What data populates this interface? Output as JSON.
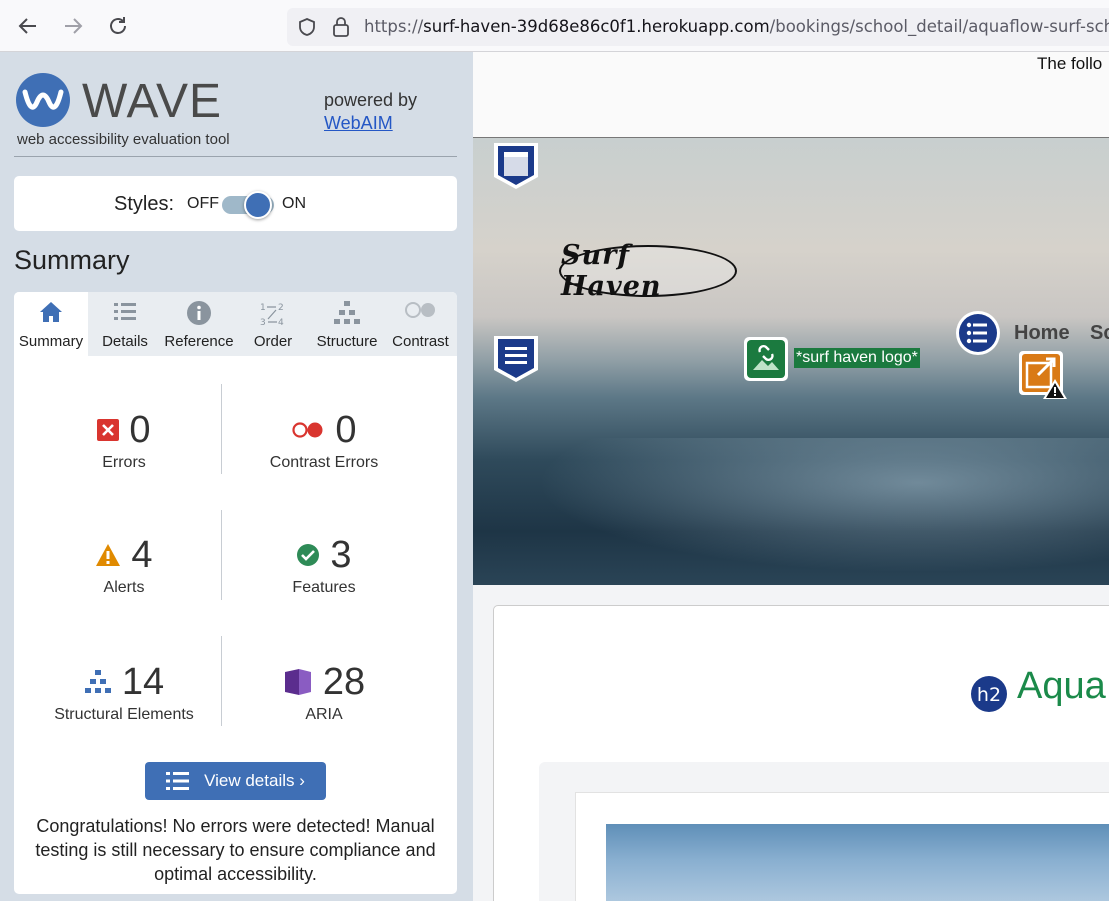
{
  "browser": {
    "url_prefix": "https://",
    "url_host": "surf-haven-39d68e86c0f1.herokuapp.com",
    "url_path": "/bookings/school_detail/aquaflow-surf-school/"
  },
  "wave": {
    "title": "WAVE",
    "subtitle": "web accessibility evaluation tool",
    "powered_by": "powered by",
    "webaim_link": "WebAIM",
    "styles_label": "Styles:",
    "styles_off": "OFF",
    "styles_on": "ON",
    "styles_state": "on",
    "summary_heading": "Summary",
    "tabs": [
      {
        "label": "Summary",
        "icon": "home-icon",
        "active": true
      },
      {
        "label": "Details",
        "icon": "list-icon"
      },
      {
        "label": "Reference",
        "icon": "info-icon"
      },
      {
        "label": "Order",
        "icon": "order-icon"
      },
      {
        "label": "Structure",
        "icon": "structure-icon"
      },
      {
        "label": "Contrast",
        "icon": "contrast-icon"
      }
    ],
    "stats": {
      "errors": {
        "count": "0",
        "label": "Errors"
      },
      "contrast_errors": {
        "count": "0",
        "label": "Contrast Errors"
      },
      "alerts": {
        "count": "4",
        "label": "Alerts"
      },
      "features": {
        "count": "3",
        "label": "Features"
      },
      "structural": {
        "count": "14",
        "label": "Structural Elements"
      },
      "aria": {
        "count": "28",
        "label": "ARIA"
      }
    },
    "view_details": "View details ›",
    "congrats": "Congratulations! No errors were detected! Manual testing is still necessary to ensure compliance and optimal accessibility."
  },
  "page": {
    "top_text": "The follo",
    "logo_text": "Surf Haven",
    "alt_tag": "*surf haven logo*",
    "nav_home": "Home",
    "nav_partial": "Sc",
    "heading_partial": "Aqua",
    "h2_badge": "h2"
  },
  "colors": {
    "wave_blue": "#3f6fb5",
    "error_red": "#d9352f",
    "alert_orange": "#e08a00",
    "feature_green": "#2e8b57",
    "aria_purple": "#5b2d8e",
    "heading_green": "#1b8a4a"
  }
}
